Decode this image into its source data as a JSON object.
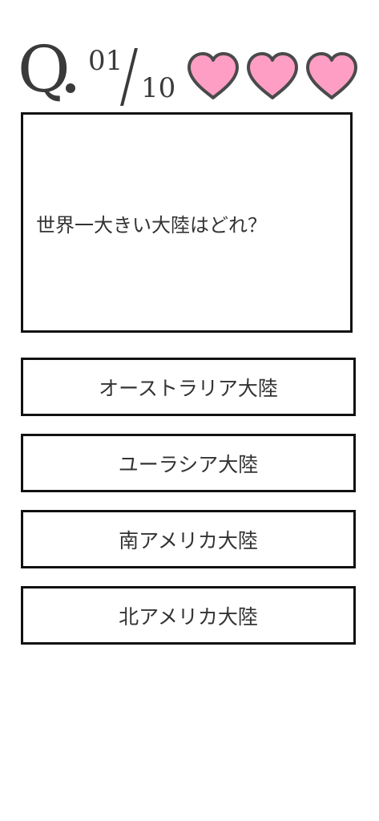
{
  "progress": {
    "prefix": "Q",
    "current": "01",
    "total": "10"
  },
  "lives": {
    "remaining": 3,
    "max": 3,
    "heart_color": "#ff9ec4",
    "heart_outline_color": "#4a4a4a"
  },
  "question": {
    "text": "世界一大きい大陸はどれ？"
  },
  "answers": [
    {
      "label": "オーストラリア大陸"
    },
    {
      "label": "ユーラシア大陸"
    },
    {
      "label": "南アメリカ大陸"
    },
    {
      "label": "北アメリカ大陸"
    }
  ]
}
